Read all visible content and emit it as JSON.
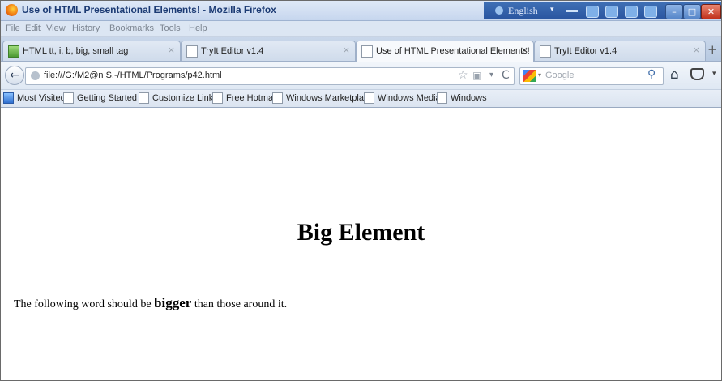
{
  "window": {
    "title": "Use of HTML Presentational Elements! - Mozilla Firefox",
    "language": "English",
    "controls": {
      "minimize": "–",
      "maximize": "□",
      "close": "✕"
    }
  },
  "menu": [
    "File",
    "Edit",
    "View",
    "History",
    "Bookmarks",
    "Tools",
    "Help"
  ],
  "tabs": [
    {
      "label": "HTML tt, i, b, big, small tag",
      "icon": "green-page-icon",
      "active": false
    },
    {
      "label": "TryIt Editor v1.4",
      "icon": "blank-page-icon",
      "active": false
    },
    {
      "label": "Use of HTML Presentational Elements!",
      "icon": "blank-page-icon",
      "active": true
    },
    {
      "label": "TryIt Editor v1.4",
      "icon": "blank-page-icon",
      "active": false
    }
  ],
  "tab_close": "×",
  "new_tab": "+",
  "nav": {
    "back": "←",
    "url": "file:///G:/M2@n S.-/HTML/Programs/p42.html",
    "star": "☆",
    "history": "▣",
    "dropdown": "▾",
    "reload": "C",
    "search_placeholder": "Google",
    "search_caret": "▾",
    "search_glass": "⚲",
    "home": "⌂",
    "more": "▾"
  },
  "bookmarks": [
    {
      "label": "Most Visited",
      "icon": "blue-globe-icon"
    },
    {
      "label": "Getting Started",
      "icon": "page-icon"
    },
    {
      "label": "Customize Links",
      "icon": "page-icon"
    },
    {
      "label": "Free Hotmail",
      "icon": "page-icon"
    },
    {
      "label": "Windows Marketplace",
      "icon": "page-icon"
    },
    {
      "label": "Windows Media",
      "icon": "page-icon"
    },
    {
      "label": "Windows",
      "icon": "page-icon"
    }
  ],
  "content": {
    "heading": "Big Element",
    "para_before": "The following word should be ",
    "para_big": "bigger",
    "para_after": " than those around it."
  }
}
